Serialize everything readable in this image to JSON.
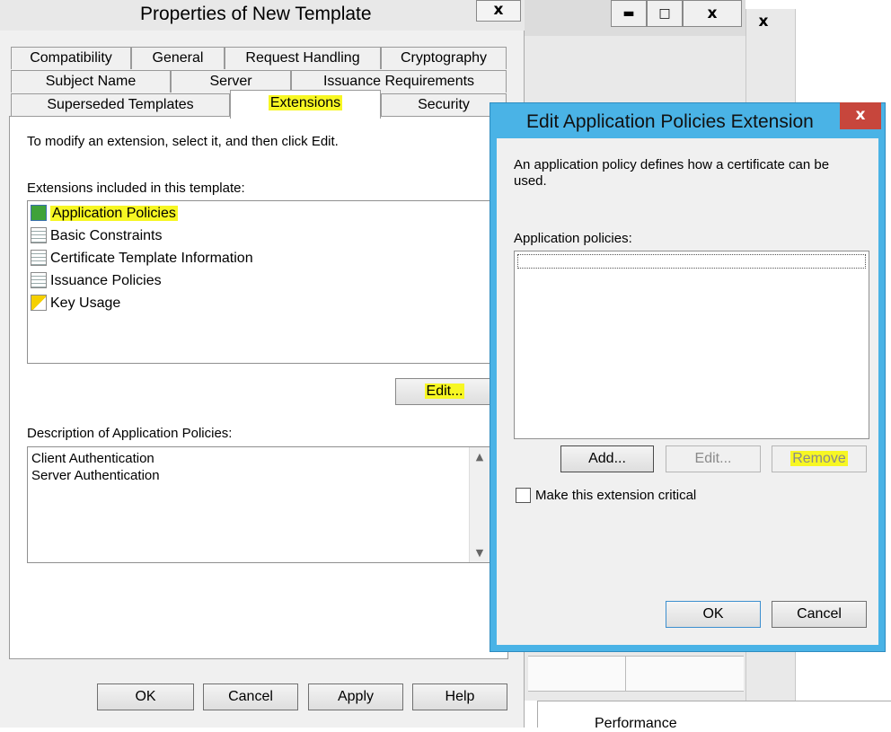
{
  "bg_windows": {
    "title_buttons": [
      "▬",
      "□",
      "x"
    ],
    "second_close": "x",
    "bottom_text": "Performance"
  },
  "props": {
    "title": "Properties of New Template",
    "close": "x",
    "tabs_row1": [
      "Compatibility",
      "General",
      "Request Handling",
      "Cryptography"
    ],
    "tabs_row2": [
      "Subject Name",
      "Server",
      "Issuance Requirements"
    ],
    "tabs_row3": [
      "Superseded Templates",
      "Extensions",
      "Security"
    ],
    "instruction": "To modify an extension, select it, and then click Edit.",
    "extensions_label": "Extensions included in this template:",
    "extensions": [
      {
        "label": "Application Policies",
        "icon": "certificate-policy-icon"
      },
      {
        "label": "Basic Constraints",
        "icon": "certificate-doc-icon"
      },
      {
        "label": "Certificate Template Information",
        "icon": "certificate-doc-icon"
      },
      {
        "label": "Issuance Policies",
        "icon": "certificate-doc-icon"
      },
      {
        "label": "Key Usage",
        "icon": "warning-cert-icon"
      }
    ],
    "edit_button": "Edit...",
    "description_label": "Description of Application Policies:",
    "description_lines": [
      "Client Authentication",
      "Server Authentication"
    ],
    "buttons": {
      "ok": "OK",
      "cancel": "Cancel",
      "apply": "Apply",
      "help": "Help"
    }
  },
  "edit_dialog": {
    "title": "Edit Application Policies Extension",
    "close": "x",
    "description": "An application policy defines how a certificate can be used.",
    "policies_label": "Application policies:",
    "add_button": "Add...",
    "edit_button": "Edit...",
    "remove_button": "Remove",
    "critical_checkbox": "Make this extension critical",
    "critical_checked": false,
    "ok_button": "OK",
    "cancel_button": "Cancel"
  },
  "colors": {
    "highlight": "#f7f723",
    "dialog_border": "#4ab3e6",
    "close_red": "#c7463c"
  }
}
